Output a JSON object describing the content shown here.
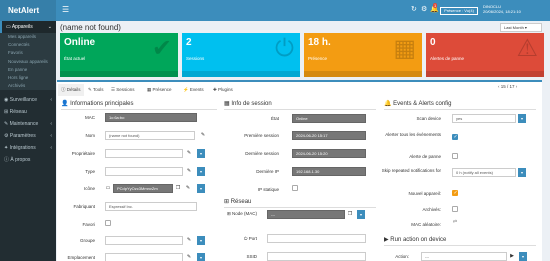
{
  "app": {
    "logo": "NetAlert",
    "badge": "1",
    "presence_label": "Présence : Vu(4)",
    "host_name": "DINOCLU",
    "host_date": "20/06/2024, 18:21:10"
  },
  "sidebar": {
    "items": [
      {
        "label": "Appareils",
        "active": true
      },
      {
        "label": "Mes appareils",
        "sub": true
      },
      {
        "label": "Connectés",
        "sub": true
      },
      {
        "label": "Favoris",
        "sub": true
      },
      {
        "label": "Nouveaux appareils",
        "sub": true
      },
      {
        "label": "En panne",
        "sub": true
      },
      {
        "label": "Hors ligne",
        "sub": true
      },
      {
        "label": "Archivés",
        "sub": true
      },
      {
        "label": "Surveillance"
      },
      {
        "label": "Réseau"
      },
      {
        "label": "Maintenance"
      },
      {
        "label": "Paramètres"
      },
      {
        "label": "Intégrations"
      },
      {
        "label": "À propos"
      }
    ]
  },
  "page": {
    "title": "(name not found)",
    "sort_select": "Last Month"
  },
  "tiles": [
    {
      "value": "Online",
      "label": "État actuel",
      "color": "#00a65a",
      "icon": "check-icon"
    },
    {
      "value": "2",
      "label": "Sessions",
      "color": "#00c0ef",
      "icon": "plug-icon"
    },
    {
      "value": "18 h.",
      "label": "Présence",
      "color": "#f39c12",
      "icon": "calendar-icon"
    },
    {
      "value": "0",
      "label": "Alertes de panne",
      "color": "#dd4b39",
      "icon": "warning-icon"
    }
  ],
  "tabs": [
    {
      "label": "Détails"
    },
    {
      "label": "Tools"
    },
    {
      "label": "Sessions"
    },
    {
      "label": "Présence"
    },
    {
      "label": "Events"
    },
    {
      "label": "Plugins"
    }
  ],
  "device_nav": "15 / 17",
  "main_info": {
    "title": "Informations principales",
    "fields": [
      {
        "label": "MAC",
        "value": "1c:6a:bc:",
        "dark": true
      },
      {
        "label": "Nom",
        "value": "(name not found)"
      },
      {
        "label": "Propriétaire",
        "value": ""
      },
      {
        "label": "Type",
        "value": ""
      },
      {
        "label": "Icône",
        "value": "PCdpYyOzc3MmnvZm",
        "dark": true
      },
      {
        "label": "Fabriquant",
        "value": "Espressif Inc."
      },
      {
        "label": "Favori",
        "value": ""
      },
      {
        "label": "Groupe",
        "value": ""
      },
      {
        "label": "Emplacement",
        "value": ""
      }
    ]
  },
  "session_info": {
    "title": "Info de session",
    "fields": [
      {
        "label": "État",
        "value": "Online"
      },
      {
        "label": "Première session",
        "value": "2024-06-20 15:17"
      },
      {
        "label": "Dernière session",
        "value": "2024-06-20 15:20"
      },
      {
        "label": "Dernière IP",
        "value": "192.168.1.30"
      },
      {
        "label": "IP statique",
        "value": ""
      }
    ]
  },
  "network": {
    "title": "Réseau",
    "fields": [
      {
        "label": "Node (MAC)",
        "value": "---"
      },
      {
        "label": "Port",
        "value": ""
      },
      {
        "label": "SSID",
        "value": ""
      }
    ]
  },
  "events_config": {
    "title": "Events & Alerts config",
    "fields": [
      {
        "label": "Scan device",
        "value": "yes"
      },
      {
        "label": "Alerter tous les évènements",
        "value": ""
      },
      {
        "label": "Alerte de panne",
        "value": ""
      },
      {
        "label": "Skip repeated notifications for",
        "value": "0 h (notify all events)"
      },
      {
        "label": "Nouvel appareil:",
        "value": ""
      },
      {
        "label": "Archivés:",
        "value": ""
      },
      {
        "label": "MAC aléatoire:",
        "value": ""
      }
    ]
  },
  "run_action": {
    "title": "Run action on device",
    "action_label": "Action:",
    "action_value": "---"
  }
}
